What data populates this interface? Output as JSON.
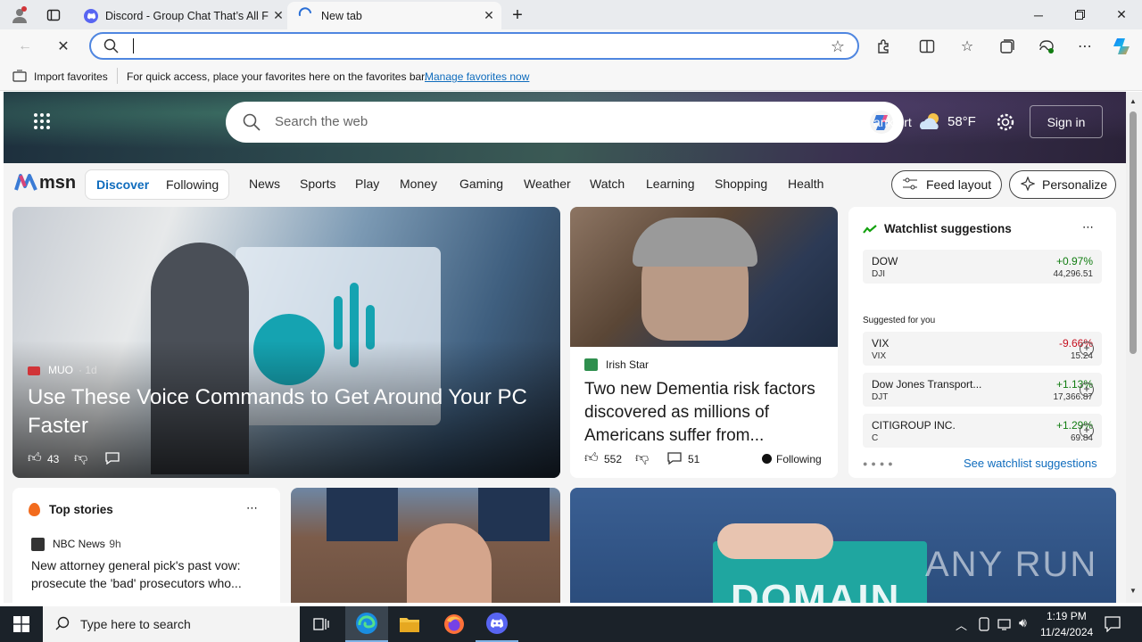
{
  "browser": {
    "tabs": [
      {
        "title": "Discord - Group Chat That’s All F",
        "icon": "discord-icon"
      },
      {
        "title": "New tab",
        "icon": "loading-spinner-icon"
      }
    ],
    "address_value": "",
    "favorites_bar": {
      "import_label": "Import favorites",
      "message": "For quick access, place your favorites here on the favorites bar.",
      "manage_link": "Manage favorites now"
    }
  },
  "msn": {
    "search_placeholder": "Search the web",
    "weather": {
      "location": "ankfurt",
      "temp": "58°F"
    },
    "signin": "Sign in",
    "logo": "msn",
    "toggle": {
      "discover": "Discover",
      "following": "Following"
    },
    "nav": [
      "News",
      "Sports",
      "Play",
      "Money",
      "Gaming",
      "Weather",
      "Watch",
      "Learning",
      "Shopping",
      "Health"
    ],
    "feed_layout": "Feed layout",
    "personalize": "Personalize",
    "hero_story": {
      "source": "MUO",
      "age": "· 1d",
      "headline": "Use These Voice Commands to Get Around Your PC Faster",
      "likes": "43"
    },
    "story2": {
      "source": "Irish Star",
      "headline": "Two new Dementia risk factors discovered as millions of Americans suffer from...",
      "likes": "552",
      "comments": "51",
      "following": "Following"
    },
    "watchlist": {
      "title": "Watchlist suggestions",
      "main": {
        "name": "DOW",
        "ticker": "DJI",
        "change": "+0.97%",
        "price": "44,296.51"
      },
      "suggested_label": "Suggested for you",
      "suggested": [
        {
          "name": "VIX",
          "ticker": "VIX",
          "change": "-9.66%",
          "price": "15.24"
        },
        {
          "name": "Dow Jones Transport...",
          "ticker": "DJT",
          "change": "+1.13%",
          "price": "17,366.87"
        },
        {
          "name": "CITIGROUP INC.",
          "ticker": "C",
          "change": "+1.29%",
          "price": "69.84"
        }
      ],
      "see_link": "See watchlist suggestions"
    },
    "top_stories": {
      "title": "Top stories",
      "source": "NBC News",
      "age": "· 9h",
      "headline": "New attorney general pick's past vow: prosecute the 'bad' prosecutors who..."
    },
    "domain_text": "DOMAIN",
    "watermark": "ANY RUN"
  },
  "taskbar": {
    "search_placeholder": "Type here to search",
    "time": "1:19 PM",
    "date": "11/24/2024"
  },
  "colors": {
    "accent": "#0f6cbd",
    "positive": "#107c10",
    "negative": "#c50f1f",
    "taskbar": "#1b2229"
  }
}
